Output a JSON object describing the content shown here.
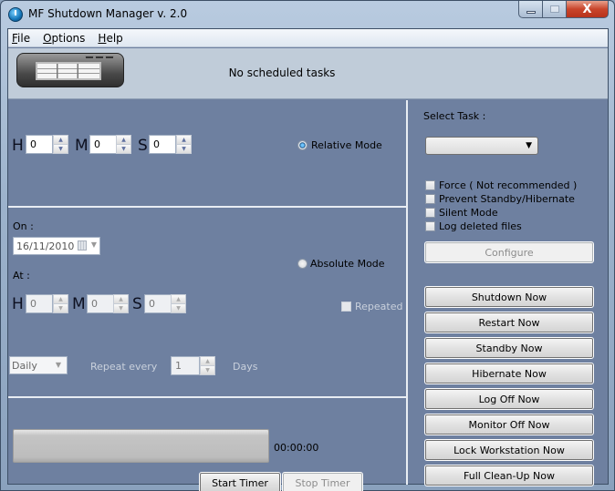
{
  "window": {
    "title": "MF Shutdown Manager v. 2.0",
    "controls": {
      "minimize": "minimize",
      "maximize": "maximize",
      "close": "X"
    }
  },
  "menu": [
    {
      "label": "File",
      "accel": "F",
      "rest": "ile"
    },
    {
      "label": "Options",
      "accel": "O",
      "rest": "ptions"
    },
    {
      "label": "Help",
      "accel": "H",
      "rest": "elp"
    }
  ],
  "header": {
    "status": "No scheduled tasks"
  },
  "relative": {
    "h_label": "H",
    "m_label": "M",
    "s_label": "S",
    "hours": "0",
    "minutes": "0",
    "seconds": "0",
    "mode_label": "Relative Mode",
    "selected": true
  },
  "absolute": {
    "on_label": "On :",
    "date": "16/11/2010",
    "at_label": "At :",
    "h_label": "H",
    "m_label": "M",
    "s_label": "S",
    "hours": "0",
    "minutes": "0",
    "seconds": "0",
    "mode_label": "Absolute Mode",
    "selected": false,
    "repeated_label": "Repeated",
    "repeat_type": "Daily",
    "repeat_every_label": "Repeat every",
    "repeat_every_value": "1",
    "repeat_unit_label": "Days"
  },
  "timer": {
    "progress": 0,
    "elapsed": "00:00:00",
    "start_label": "Start Timer",
    "stop_label": "Stop Timer"
  },
  "task_panel": {
    "select_label": "Select Task :",
    "selected_task": "",
    "options": [
      {
        "label": "Force ( Not recommended )",
        "checked": false
      },
      {
        "label": "Prevent Standby/Hibernate",
        "checked": false
      },
      {
        "label": "Silent Mode",
        "checked": false
      },
      {
        "label": "Log deleted files",
        "checked": false
      }
    ],
    "configure_label": "Configure",
    "actions": [
      "Shutdown Now",
      "Restart Now",
      "Standby Now",
      "Hibernate Now",
      "Log Off Now",
      "Monitor Off Now",
      "Lock Workstation Now",
      "Full Clean-Up Now"
    ]
  }
}
